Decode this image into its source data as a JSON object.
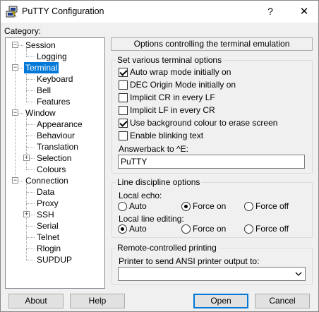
{
  "window": {
    "title": "PuTTY Configuration",
    "help_glyph": "?",
    "close_glyph": "✕",
    "icon": "putty-terminal-icon"
  },
  "category": {
    "label": "Category:",
    "tree": [
      {
        "label": "Session",
        "level": 0,
        "expander": "minus"
      },
      {
        "label": "Logging",
        "level": 1
      },
      {
        "label": "Terminal",
        "level": 0,
        "expander": "minus",
        "selected": true
      },
      {
        "label": "Keyboard",
        "level": 1
      },
      {
        "label": "Bell",
        "level": 1
      },
      {
        "label": "Features",
        "level": 1
      },
      {
        "label": "Window",
        "level": 0,
        "expander": "minus"
      },
      {
        "label": "Appearance",
        "level": 1
      },
      {
        "label": "Behaviour",
        "level": 1
      },
      {
        "label": "Translation",
        "level": 1
      },
      {
        "label": "Selection",
        "level": 1,
        "expander": "plus"
      },
      {
        "label": "Colours",
        "level": 1
      },
      {
        "label": "Connection",
        "level": 0,
        "expander": "minus"
      },
      {
        "label": "Data",
        "level": 1
      },
      {
        "label": "Proxy",
        "level": 1
      },
      {
        "label": "SSH",
        "level": 1,
        "expander": "plus"
      },
      {
        "label": "Serial",
        "level": 1
      },
      {
        "label": "Telnet",
        "level": 1
      },
      {
        "label": "Rlogin",
        "level": 1
      },
      {
        "label": "SUPDUP",
        "level": 1
      }
    ]
  },
  "panel": {
    "header": "Options controlling the terminal emulation",
    "terminal_options": {
      "title": "Set various terminal options",
      "checkboxes": [
        {
          "label": "Auto wrap mode initially on",
          "checked": true
        },
        {
          "label": "DEC Origin Mode initially on",
          "checked": false
        },
        {
          "label": "Implicit CR in every LF",
          "checked": false
        },
        {
          "label": "Implicit LF in every CR",
          "checked": false
        },
        {
          "label": "Use background colour to erase screen",
          "checked": true
        },
        {
          "label": "Enable blinking text",
          "checked": false
        }
      ],
      "answerback_label": "Answerback to ^E:",
      "answerback_value": "PuTTY"
    },
    "line_discipline": {
      "title": "Line discipline options",
      "local_echo_label": "Local echo:",
      "local_echo_options": [
        {
          "label": "Auto",
          "selected": false
        },
        {
          "label": "Force on",
          "selected": true
        },
        {
          "label": "Force off",
          "selected": false
        }
      ],
      "local_editing_label": "Local line editing:",
      "local_editing_options": [
        {
          "label": "Auto",
          "selected": true
        },
        {
          "label": "Force on",
          "selected": false
        },
        {
          "label": "Force off",
          "selected": false
        }
      ]
    },
    "remote_printing": {
      "title": "Remote-controlled printing",
      "printer_label": "Printer to send ANSI printer output to:",
      "printer_value": ""
    }
  },
  "buttons": {
    "about": "About",
    "help": "Help",
    "open": "Open",
    "cancel": "Cancel"
  },
  "colors": {
    "selection": "#0078d7",
    "window_bg": "#f0f0f0"
  }
}
